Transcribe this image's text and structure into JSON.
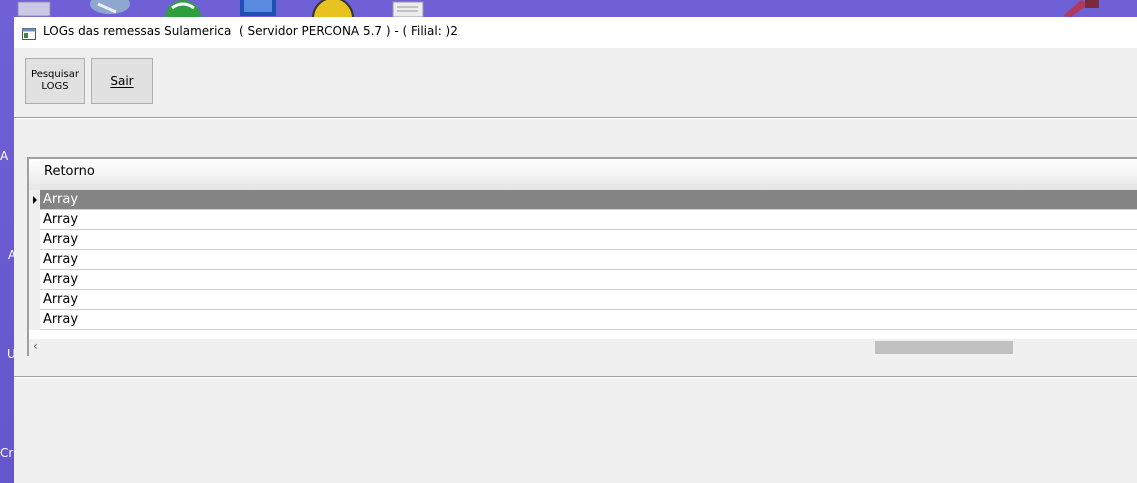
{
  "window": {
    "title": "LOGs das remessas Sulamerica  ( Servidor PERCONA 5.7 ) - ( Filial: )2"
  },
  "toolbar": {
    "pesquisar_label_line1": "Pesquisar",
    "pesquisar_label_line2": "LOGS",
    "sair_label": "Sair"
  },
  "grid": {
    "columns": [
      "Retorno"
    ],
    "rows": [
      "Array",
      "Array",
      "Array",
      "Array",
      "Array",
      "Array",
      "Array"
    ],
    "selected_row": 0,
    "scroll_left_glyph": "‹"
  },
  "desktop": {
    "labels": [
      "A",
      "A",
      "U",
      "Cr"
    ]
  },
  "colors": {
    "desktop": "#6a5acd",
    "selection": "#848484",
    "window_bg": "#f0f0f0"
  }
}
